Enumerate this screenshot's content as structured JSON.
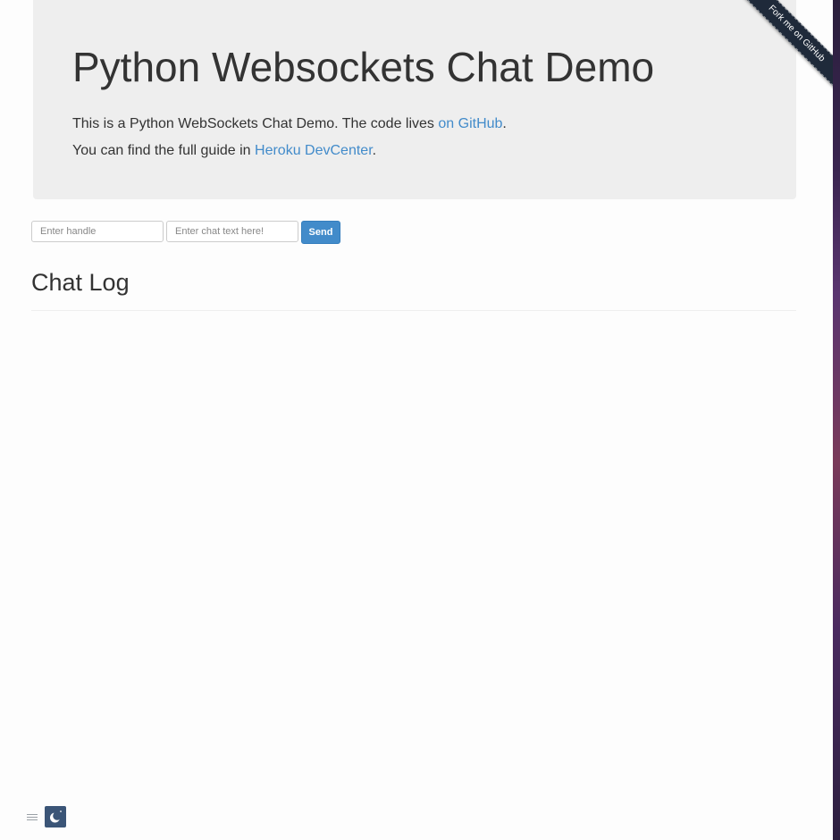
{
  "jumbotron": {
    "title": "Python Websockets Chat Demo",
    "line1_prefix": "This is a Python WebSockets Chat Demo. The code lives ",
    "line1_link": "on GitHub",
    "line1_suffix": ".",
    "line2_prefix": "You can find the full guide in ",
    "line2_link": "Heroku DevCenter",
    "line2_suffix": "."
  },
  "ribbon": {
    "label": "Fork me on GitHub"
  },
  "form": {
    "handle_placeholder": "Enter handle",
    "handle_value": "",
    "text_placeholder": "Enter chat text here!",
    "text_value": "",
    "send_label": "Send"
  },
  "chat": {
    "heading": "Chat Log",
    "messages": []
  },
  "widgets": {
    "menu_icon": "hamburger-icon",
    "theme_icon": "moon-icon"
  },
  "colors": {
    "link": "#428bca",
    "button": "#428bca",
    "jumbotron_bg": "#eeeeee",
    "ribbon": "#1f2a3a"
  }
}
